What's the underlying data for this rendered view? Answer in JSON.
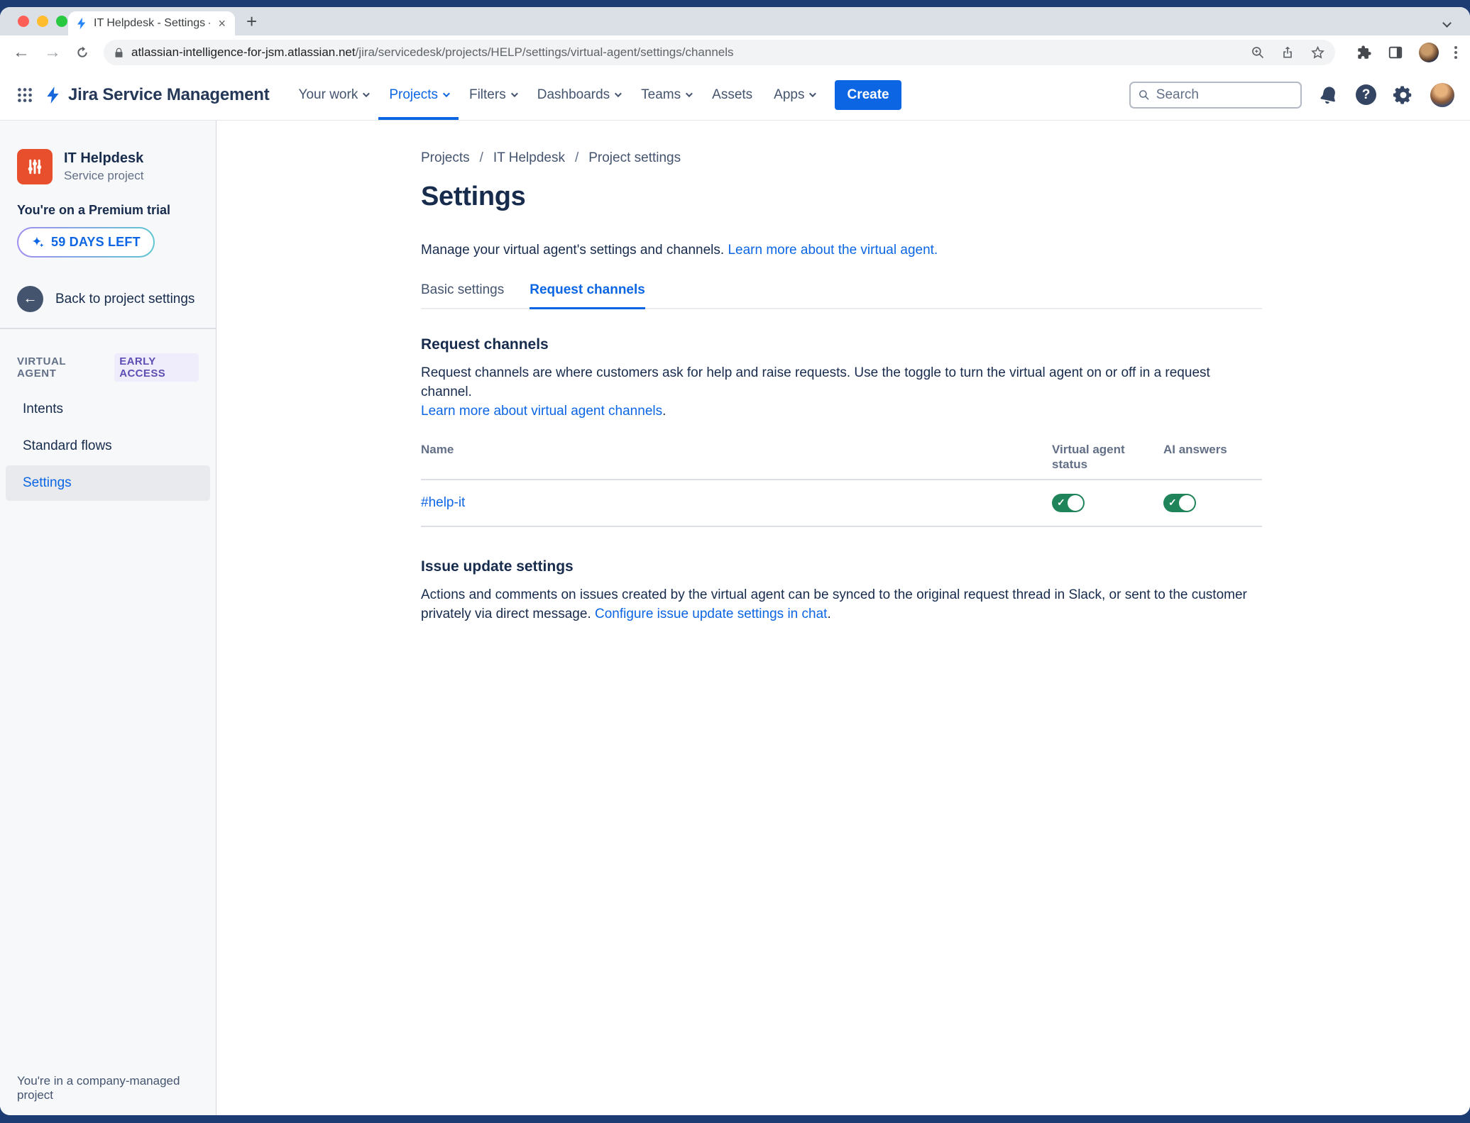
{
  "browser": {
    "tab_title": "IT Helpdesk - Settings - Servic",
    "url_host": "atlassian-intelligence-for-jsm.atlassian.net",
    "url_path": "/jira/servicedesk/projects/HELP/settings/virtual-agent/settings/channels",
    "close_glyph": "×",
    "newtab_glyph": "+",
    "back_glyph": "←",
    "forward_glyph": "→"
  },
  "topnav": {
    "brand": "Jira Service Management",
    "items": [
      {
        "label": "Your work",
        "dropdown": true
      },
      {
        "label": "Projects",
        "dropdown": true
      },
      {
        "label": "Filters",
        "dropdown": true
      },
      {
        "label": "Dashboards",
        "dropdown": true
      },
      {
        "label": "Teams",
        "dropdown": true
      },
      {
        "label": "Assets",
        "dropdown": false
      },
      {
        "label": "Apps",
        "dropdown": true
      }
    ],
    "active_item": "Projects",
    "create_label": "Create",
    "search_placeholder": "Search",
    "help_glyph": "?"
  },
  "sidebar": {
    "project_name": "IT Helpdesk",
    "project_type": "Service project",
    "trial_text": "You're on a Premium trial",
    "trial_badge": "59 DAYS LEFT",
    "back_label": "Back to project settings",
    "section_label": "VIRTUAL AGENT",
    "section_badge": "EARLY ACCESS",
    "items": [
      {
        "label": "Intents",
        "active": false
      },
      {
        "label": "Standard flows",
        "active": false
      },
      {
        "label": "Settings",
        "active": true
      }
    ],
    "footer": "You're in a company-managed project"
  },
  "main": {
    "breadcrumb": {
      "sep": "/",
      "items": [
        "Projects",
        "IT Helpdesk",
        "Project settings"
      ]
    },
    "title": "Settings",
    "intro_text": "Manage your virtual agent's settings and channels.",
    "intro_link": "Learn more about the virtual agent.",
    "tabs": [
      {
        "label": "Basic settings",
        "active": false
      },
      {
        "label": "Request channels",
        "active": true
      }
    ],
    "request_channels": {
      "heading": "Request channels",
      "description": "Request channels are where customers ask for help and raise requests. Use the toggle to turn the virtual agent on or off in a request channel.",
      "link": "Learn more about virtual agent channels",
      "link_suffix": ".",
      "table": {
        "columns": [
          "Name",
          "Virtual agent status",
          "AI answers"
        ],
        "rows": [
          {
            "name": "#help-it",
            "virtual_agent_status": true,
            "ai_answers": true
          }
        ],
        "check_glyph": "✓"
      }
    },
    "issue_update": {
      "heading": "Issue update settings",
      "description": "Actions and comments on issues created by the virtual agent can be synced to the original request thread in Slack, or sent to the customer privately via direct message.",
      "link": "Configure issue update settings in chat",
      "link_suffix": "."
    }
  },
  "colors": {
    "accent_blue": "#0C66E4",
    "toggle_green": "#1F845A",
    "brand_navy": "#253858",
    "project_icon_orange": "#E8502D",
    "badge_purple": "#5E4DB2",
    "desktop_navy": "#1E3C74"
  }
}
